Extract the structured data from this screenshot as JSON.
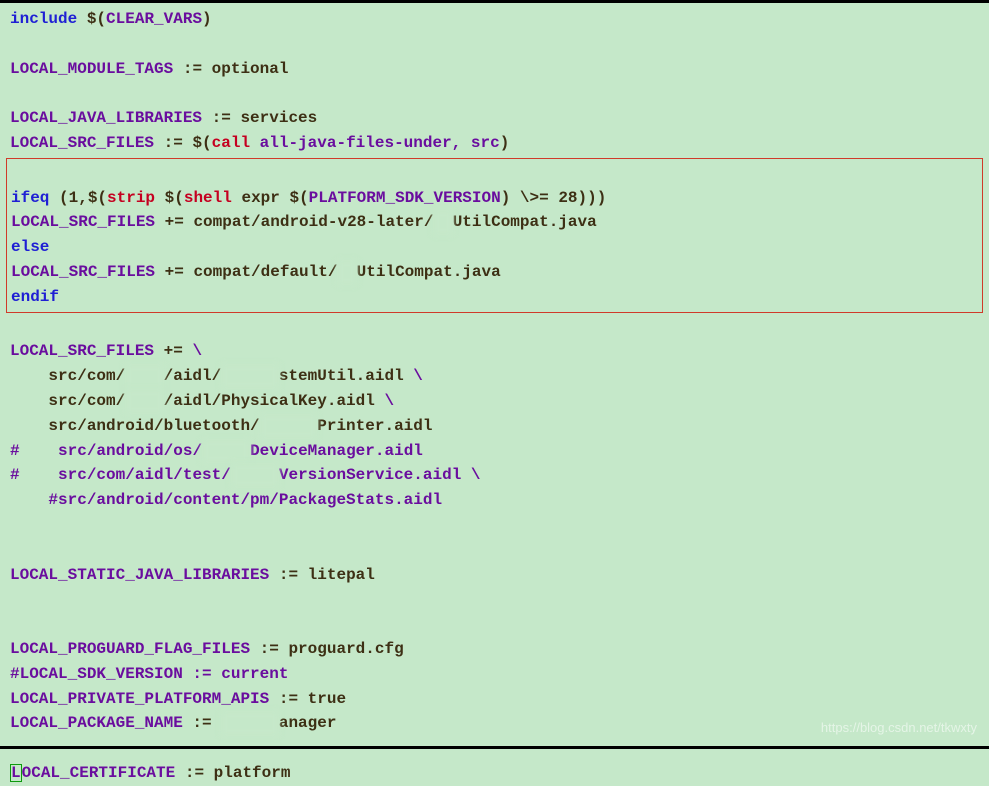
{
  "code": {
    "l1_include": "include",
    "l1_dollar_open": " $(",
    "l1_var": "CLEAR_VARS",
    "l1_close": ")",
    "l3_var": "LOCAL_MODULE_TAGS",
    "l3_assign": " := optional",
    "l5_var": "LOCAL_JAVA_LIBRARIES",
    "l5_assign": " := services",
    "l6_var": "LOCAL_SRC_FILES",
    "l6_assign_pre": " := ",
    "l6_dollar": "$(",
    "l6_call": "call",
    "l6_args": " all-java-files-under, src",
    "l6_close": ")",
    "box": {
      "l8_ifeq": "ifeq",
      "l8_open": " (1,",
      "l8_dollar1": "$(",
      "l8_strip": "strip",
      "l8_space1": " ",
      "l8_dollar2": "$(",
      "l8_shell": "shell",
      "l8_expr_pre": " expr ",
      "l8_dollar3": "$(",
      "l8_platvar": "PLATFORM_SDK_VERSION",
      "l8_close3": ")",
      "l8_tail": " \\>= 28)))",
      "l9_var": "LOCAL_SRC_FILES",
      "l9_pre": " += compat/android-v28-later/",
      "l9_redact": "  ",
      "l9_post": "UtilCompat.java",
      "l10_else": "else",
      "l11_var": "LOCAL_SRC_FILES",
      "l11_pre": " += compat/default/",
      "l11_redact": "  ",
      "l11_post": "UtilCompat.java",
      "l12_endif": "endif"
    },
    "l14": {
      "var": "LOCAL_SRC_FILES",
      "plain": " += ",
      "cont": "\\"
    },
    "l15_pre": "    src/com/",
    "l15_r": "    ",
    "l15_mid": "/aidl/",
    "l15_r2": "      ",
    "l15_post": "stemUtil.aidl ",
    "l15_cont": "\\",
    "l16_pre": "    src/com/",
    "l16_r": "    ",
    "l16_mid": "/aidl/PhysicalKey.aidl ",
    "l16_cont": "\\",
    "l17_pre": "    src/android/bluetooth/",
    "l17_r": "      ",
    "l17_post": "Printer.aidl",
    "l18_hash": "#",
    "l18_pre": "    src/android/os/",
    "l18_r": "     ",
    "l18_post": "DeviceManager.aidl",
    "l19_hash": "#",
    "l19_pre": "    src/com/aidl/test/",
    "l19_r": "     ",
    "l19_post": "VersionService.aidl \\",
    "l20": "    #src/android/content/pm/PackageStats.aidl",
    "l23_var": "LOCAL_STATIC_JAVA_LIBRARIES",
    "l23_assign": " := litepal",
    "l26_var": "LOCAL_PROGUARD_FLAG_FILES",
    "l26_assign": " := proguard.cfg",
    "l27": "#LOCAL_SDK_VERSION := current",
    "l28_var": "LOCAL_PRIVATE_PLATFORM_APIS",
    "l28_assign": " := true",
    "l29_var": "LOCAL_PACKAGE_NAME",
    "l29_pre": " := ",
    "l29_r": "      ",
    "l29_post": "anager",
    "l31_L": "L",
    "l31_var": "OCAL_CERTIFICATE",
    "l31_assign": " := platform"
  },
  "watermark": "https://blog.csdn.net/tkwxty"
}
